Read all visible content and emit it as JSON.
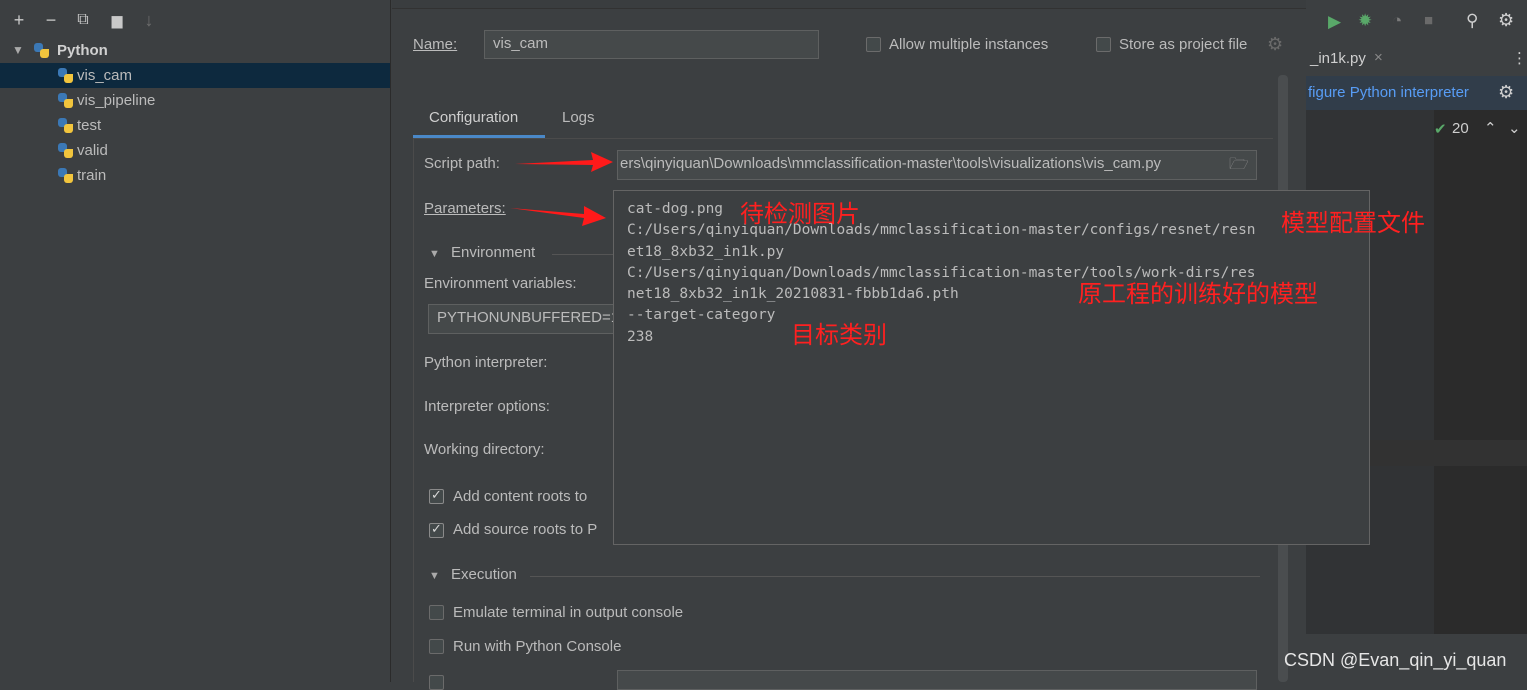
{
  "sidebar": {
    "toolbar": [
      {
        "name": "add-icon",
        "glyph": "+"
      },
      {
        "name": "remove-icon",
        "glyph": "−"
      },
      {
        "name": "copy-icon",
        "glyph": "⧉"
      },
      {
        "name": "new-folder-icon",
        "glyph": "▆"
      },
      {
        "name": "sort-icon",
        "glyph": "↓"
      }
    ],
    "root": "Python",
    "items": [
      "vis_cam",
      "vis_pipeline",
      "test",
      "valid",
      "train"
    ]
  },
  "dialog": {
    "name_label": "Name:",
    "name_value": "vis_cam",
    "allow_multiple": "Allow multiple instances",
    "store_as_file": "Store as project file",
    "tabs": [
      "Configuration",
      "Logs"
    ],
    "script_path_label": "Script path:",
    "script_path_value": "ers\\qinyiquan\\Downloads\\mmclassification-master\\tools\\visualizations\\vis_cam.py",
    "parameters_label": "Parameters:",
    "environment_section": "Environment",
    "env_vars_label": "Environment variables:",
    "env_vars_value": "PYTHONUNBUFFERED=1",
    "python_interpreter_label": "Python interpreter:",
    "interpreter_options_label": "Interpreter options:",
    "working_dir_label": "Working directory:",
    "add_content_roots": "Add content roots to",
    "add_source_roots": "Add source roots to P",
    "execution_section": "Execution",
    "emulate_terminal": "Emulate terminal in output console",
    "run_with_console": "Run with Python Console"
  },
  "params_popup": {
    "lines": [
      "cat-dog.png",
      "C:/Users/qinyiquan/Downloads/mmclassification-master/configs/resnet/resn",
      "et18_8xb32_in1k.py",
      "C:/Users/qinyiquan/Downloads/mmclassification-master/tools/work-dirs/res",
      "net18_8xb32_in1k_20210831-fbbb1da6.pth",
      "--target-category",
      "238"
    ]
  },
  "annotations": {
    "image_to_detect": "待检测图片",
    "model_config": "模型配置文件",
    "trained_model": "原工程的训练好的模型",
    "target_category": "目标类别"
  },
  "editor": {
    "tab_label": "_in1k.py",
    "banner": "figure Python interpreter",
    "problems_count": "20"
  },
  "watermark": "CSDN @Evan_qin_yi_quan",
  "colors": {
    "annotation": "#ff2020",
    "selection": "#0d293e",
    "run_green": "#59a869"
  }
}
